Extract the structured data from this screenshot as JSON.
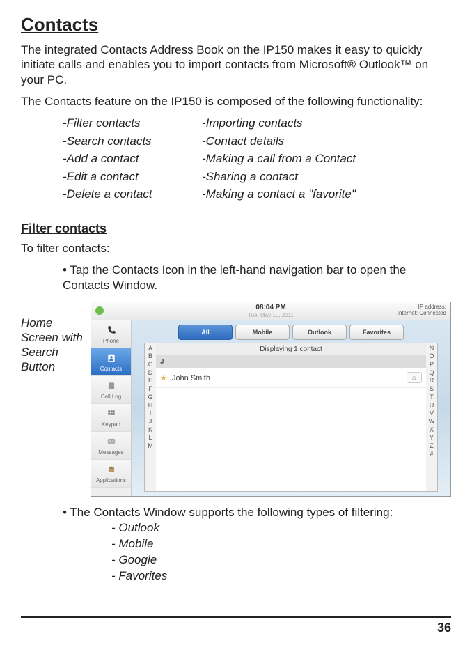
{
  "title": "Contacts",
  "intro": "The integrated Contacts Address Book on the IP150 makes it easy to quickly initiate calls and enables you to import contacts from Microsoft® Outlook™ on your PC.",
  "compose": "The Contacts feature on the IP150 is composed of the following functionality:",
  "features_left": [
    "-Filter contacts",
    "-Search contacts",
    "-Add a contact",
    "-Edit a contact",
    "-Delete a contact"
  ],
  "features_right": [
    "-Importing contacts",
    "-Contact details",
    "-Making a call from a Contact",
    "-Sharing a contact",
    "-Making a contact a \"favorite\""
  ],
  "subheading": "Filter contacts",
  "step_intro": "To filter contacts:",
  "bullet1": "• Tap the Contacts Icon in the left-hand navigation bar to open the Contacts Window.",
  "caption": "Home Screen with Search Button",
  "screenshot": {
    "time": "08:04 PM",
    "date": "Tue, May 10, 2011",
    "ip_label": "IP address:",
    "net_status": "Internet: Connected",
    "sidebar": [
      "Phone",
      "Contacts",
      "Call Log",
      "Keypad",
      "Messages",
      "Applications"
    ],
    "tabs": [
      "All",
      "Mobile",
      "Outlook",
      "Favorites"
    ],
    "display_msg": "Displaying 1 contact",
    "group": "J",
    "contact_name": "John Smith",
    "alpha_left": [
      "A",
      "B",
      "C",
      "D",
      "E",
      "F",
      "G",
      "H",
      "I",
      "J",
      "K",
      "L",
      "M"
    ],
    "alpha_right": [
      "N",
      "O",
      "P",
      "Q",
      "R",
      "S",
      "T",
      "U",
      "V",
      "W",
      "X",
      "Y",
      "Z",
      "#"
    ]
  },
  "bullet2": "• The Contacts Window supports the following types of filtering:",
  "filter_types": [
    "- Outlook",
    "- Mobile",
    "- Google",
    "- Favorites"
  ],
  "page_number": "36"
}
